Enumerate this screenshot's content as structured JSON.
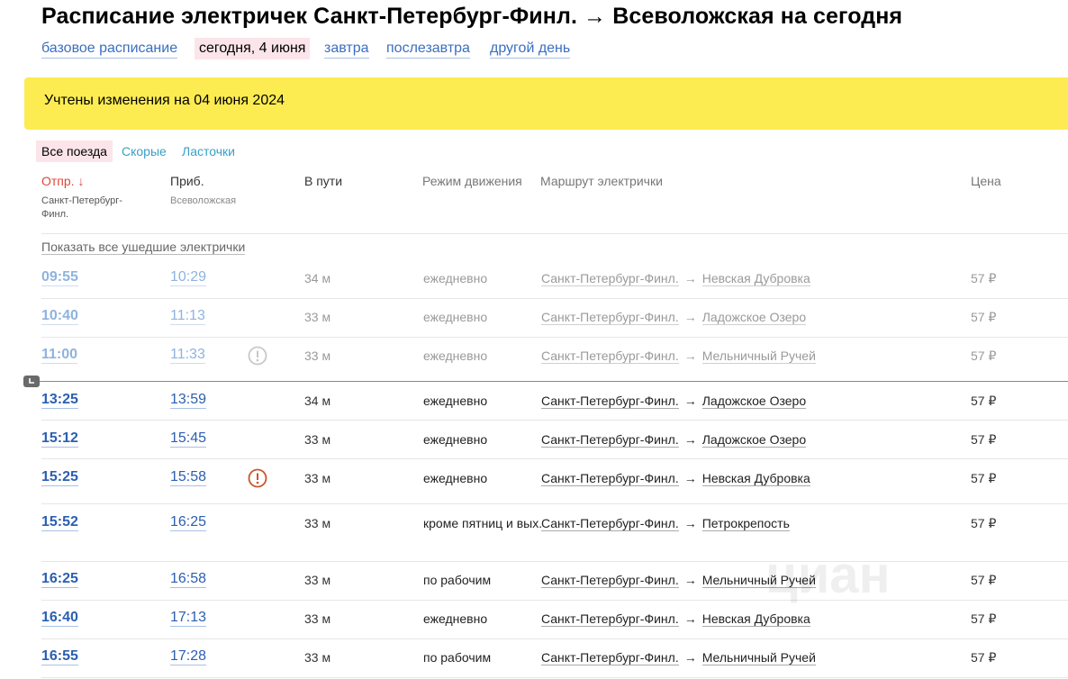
{
  "header": {
    "title": "Расписание электричек Санкт-Петербург-Финл. → Всеволожская на сегодня"
  },
  "day_nav": {
    "base": "базовое расписание",
    "today": "сегодня, 4 июня",
    "tomorrow": "завтра",
    "after_tomorrow": "послезавтра",
    "other": "другой день"
  },
  "notice": {
    "text": "Учтены изменения на 04 июня 2024"
  },
  "filters": {
    "all": "Все поезда",
    "fast": "Скорые",
    "lastochki": "Ласточки"
  },
  "columns": {
    "dep": "Отпр. ↓",
    "dep_station": "Санкт-Петербург-Финл.",
    "arr": "Приб.",
    "arr_station": "Всеволожская",
    "duration": "В пути",
    "mode": "Режим движения",
    "route": "Маршрут электрички",
    "price": "Цена"
  },
  "show_past": "Показать все ушедшие электрички",
  "colors": {
    "notice": "#fcec51",
    "link": "#2b5fb0",
    "warning": "#c8562a",
    "active_tab": "#fbe5ea"
  },
  "icons": {
    "warning": "warning-circle-icon",
    "now": "clock-marker-icon"
  },
  "trains": [
    {
      "dep": "09:55",
      "arr": "10:29",
      "dur": "34 м",
      "mode": "ежедневно",
      "from": "Санкт-Петербург-Финл.",
      "arrow": "→",
      "to": "Невская Дубровка",
      "price": "57 ₽",
      "past": true,
      "warning": false
    },
    {
      "dep": "10:40",
      "arr": "11:13",
      "dur": "33 м",
      "mode": "ежедневно",
      "from": "Санкт-Петербург-Финл.",
      "arrow": "→",
      "to": "Ладожское Озеро",
      "price": "57 ₽",
      "past": true,
      "warning": false
    },
    {
      "dep": "11:00",
      "arr": "11:33",
      "dur": "33 м",
      "mode": "ежедневно",
      "from": "Санкт-Петербург-Финл.",
      "arrow": "→",
      "to": "Мельничный Ручей",
      "price": "57 ₽",
      "past": true,
      "warning": true
    },
    {
      "dep": "13:25",
      "arr": "13:59",
      "dur": "34 м",
      "mode": "ежедневно",
      "from": "Санкт-Петербург-Финл.",
      "arrow": "→",
      "to": "Ладожское Озеро",
      "price": "57 ₽",
      "past": false,
      "warning": false
    },
    {
      "dep": "15:12",
      "arr": "15:45",
      "dur": "33 м",
      "mode": "ежедневно",
      "from": "Санкт-Петербург-Финл.",
      "arrow": "→",
      "to": "Ладожское Озеро",
      "price": "57 ₽",
      "past": false,
      "warning": false
    },
    {
      "dep": "15:25",
      "arr": "15:58",
      "dur": "33 м",
      "mode": "ежедневно",
      "from": "Санкт-Петербург-Финл.",
      "arrow": "→",
      "to": "Невская Дубровка",
      "price": "57 ₽",
      "past": false,
      "warning": true
    },
    {
      "dep": "15:52",
      "arr": "16:25",
      "dur": "33 м",
      "mode": "кроме пятниц и вых.",
      "from": "Санкт-Петербург-Финл.",
      "arrow": "→",
      "to": "Петрокрепость",
      "price": "57 ₽",
      "past": false,
      "warning": false
    },
    {
      "dep": "16:25",
      "arr": "16:58",
      "dur": "33 м",
      "mode": "по рабочим",
      "from": "Санкт-Петербург-Финл.",
      "arrow": "→",
      "to": "Мельничный Ручей",
      "price": "57 ₽",
      "past": false,
      "warning": false
    },
    {
      "dep": "16:40",
      "arr": "17:13",
      "dur": "33 м",
      "mode": "ежедневно",
      "from": "Санкт-Петербург-Финл.",
      "arrow": "→",
      "to": "Невская Дубровка",
      "price": "57 ₽",
      "past": false,
      "warning": false
    },
    {
      "dep": "16:55",
      "arr": "17:28",
      "dur": "33 м",
      "mode": "по рабочим",
      "from": "Санкт-Петербург-Финл.",
      "arrow": "→",
      "to": "Мельничный Ручей",
      "price": "57 ₽",
      "past": false,
      "warning": false
    }
  ]
}
